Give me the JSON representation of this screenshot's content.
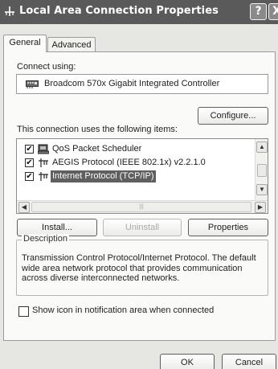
{
  "window": {
    "title": "Local Area Connection Properties",
    "help_label": "?",
    "close_label": "X"
  },
  "tabs": [
    {
      "label": "General",
      "selected": true
    },
    {
      "label": "Advanced",
      "selected": false
    }
  ],
  "general": {
    "connect_using_label": "Connect using:",
    "device_name": "Broadcom 570x Gigabit Integrated Controller",
    "configure_button": "Configure...",
    "items_label": "This connection uses the following items:",
    "items": [
      {
        "label": "QoS Packet Scheduler",
        "checked": true,
        "icon": "scheduler-icon",
        "selected": false
      },
      {
        "label": "AEGIS Protocol (IEEE 802.1x) v2.2.1.0",
        "checked": true,
        "icon": "protocol-icon",
        "selected": false
      },
      {
        "label": "Internet Protocol (TCP/IP)",
        "checked": true,
        "icon": "protocol-icon",
        "selected": true
      }
    ],
    "check_mark": "✔",
    "install_button": "Install...",
    "uninstall_button": "Uninstall",
    "properties_button": "Properties",
    "description_title": "Description",
    "description_text": "Transmission Control Protocol/Internet Protocol. The default wide area network protocol that provides communication across diverse interconnected networks.",
    "show_icon_label": "Show icon in notification area when connected",
    "show_icon_checked": false
  },
  "footer": {
    "ok_button": "OK",
    "cancel_button": "Cancel"
  },
  "colors": {
    "titlebar": "#5a5a5a",
    "selection": "#5f5f5f",
    "window_bg": "#e6e6e3",
    "panel_bg": "#fafaf8"
  }
}
